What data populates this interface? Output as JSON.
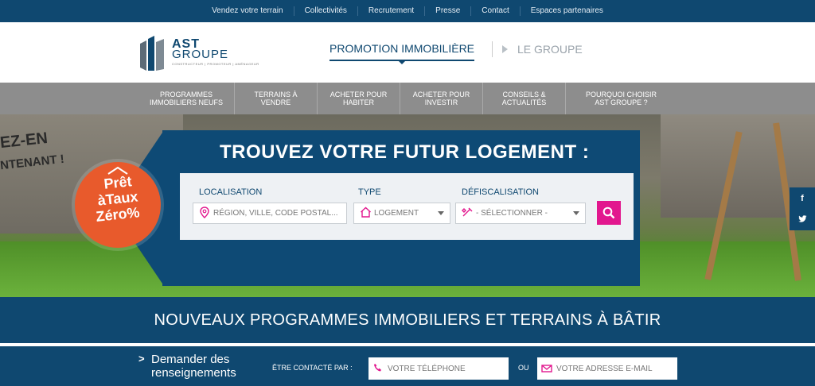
{
  "topbar": {
    "links": [
      "Vendez votre terrain",
      "Collectivités",
      "Recrutement",
      "Presse",
      "Contact",
      "Espaces partenaires"
    ]
  },
  "logo": {
    "line1": "AST",
    "line2": "GROUPE",
    "tagline": "CONSTRUCTEUR | PROMOTEUR | AMÉNAGEUR"
  },
  "mainnav": {
    "active": "PROMOTION IMMOBILIÈRE",
    "other": "LE GROUPE"
  },
  "subnav": [
    {
      "l1": "PROGRAMMES",
      "l2": "IMMOBILIERS NEUFS"
    },
    {
      "l1": "TERRAINS À",
      "l2": "VENDRE"
    },
    {
      "l1": "ACHETER POUR",
      "l2": "HABITER"
    },
    {
      "l1": "ACHETER POUR",
      "l2": "INVESTIR"
    },
    {
      "l1": "CONSEILS &",
      "l2": "ACTUALITÉS"
    },
    {
      "l1": "POURQUOI CHOISIR",
      "l2": "AST GROUPE ?"
    }
  ],
  "hero": {
    "slogan_line1": "EZ-EN",
    "slogan_line2": "NTENANT !",
    "badge": {
      "l1": "Prêt",
      "l2": "àTaux",
      "l3": "Zéro%"
    },
    "title": "TROUVEZ VOTRE FUTUR LOGEMENT :",
    "search": {
      "loc_label": "LOCALISATION",
      "loc_placeholder": "RÉGION, VILLE, CODE POSTAL...",
      "type_label": "TYPE",
      "type_value": "LOGEMENT",
      "defisc_label": "DÉFISCALISATION",
      "defisc_value": "- SÉLECTIONNER -"
    }
  },
  "social": {
    "facebook": "f",
    "twitter": "t"
  },
  "banner": {
    "title": "NOUVEAUX PROGRAMMES IMMOBILIERS ET TERRAINS À BÂTIR"
  },
  "contact": {
    "chevron": ">",
    "ask_l1": "Demander des",
    "ask_l2": "renseignements",
    "by": "ÊTRE CONTACTÉ PAR :",
    "phone_placeholder": "VOTRE TÉLÉPHONE",
    "or": "OU",
    "email_placeholder": "VOTRE ADRESSE E-MAIL"
  },
  "colors": {
    "brand": "#0f4870",
    "accent": "#e2178e",
    "badge": "#e85a2c",
    "subnav": "#8d8d8d"
  }
}
